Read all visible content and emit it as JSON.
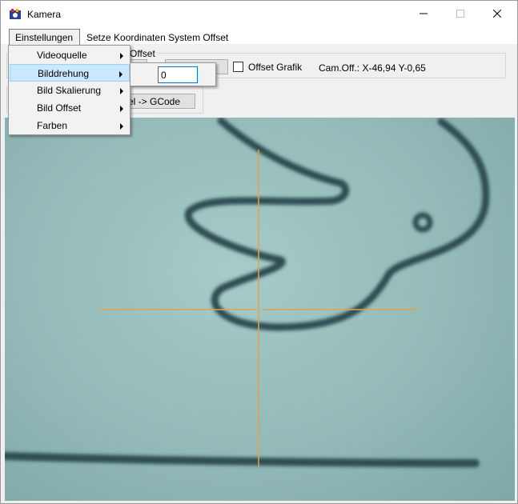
{
  "window": {
    "title": "Kamera",
    "colors": {
      "crosshair": "#e2a24a",
      "camera_bg": "#93bab8",
      "drawing": "#2f4e52"
    }
  },
  "titlebar": {
    "minimize_icon": "minimize-icon",
    "maximize_icon": "maximize-icon",
    "close_icon": "close-icon"
  },
  "menubar": {
    "items": [
      {
        "label": "Einstellungen"
      },
      {
        "label": "Setze Koordinaten System Offset"
      }
    ]
  },
  "toolbar": {
    "group_label": "Offset",
    "offset_grafik_label": "Offset Grafik",
    "offset_grafik_checked": false,
    "cam_offset": "Cam.Off.: X-46,94 Y-0,65",
    "pixel_gcode_button": "el -> GCode"
  },
  "dropdown": {
    "items": [
      {
        "label": "Videoquelle",
        "has_submenu": true
      },
      {
        "label": "Bilddrehung",
        "has_submenu": true,
        "selected": true
      },
      {
        "label": "Bild Skalierung",
        "has_submenu": true
      },
      {
        "label": "Bild Offset",
        "has_submenu": true
      },
      {
        "label": "Farben",
        "has_submenu": true
      }
    ]
  },
  "submenu": {
    "rotation_value": "0"
  }
}
